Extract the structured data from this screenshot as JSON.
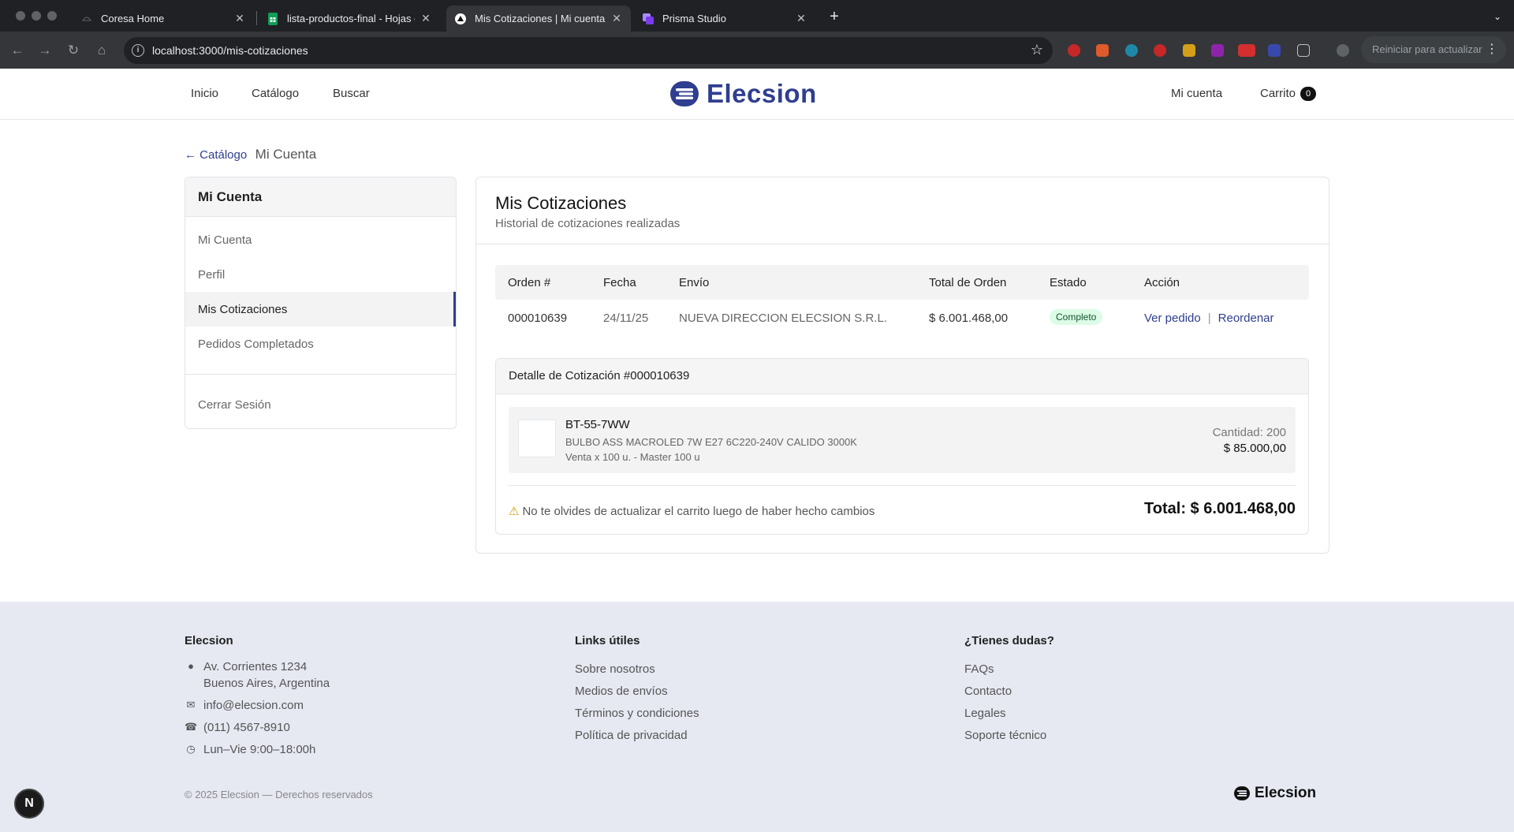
{
  "browser": {
    "tabs": [
      {
        "title": "Coresa Home",
        "icon": "coresa-favicon"
      },
      {
        "title": "lista-productos-final - Hojas de",
        "icon": "sheets-favicon"
      },
      {
        "title": "Mis Cotizaciones | Mi cuenta | ",
        "icon": "vercel-favicon"
      },
      {
        "title": "Prisma Studio",
        "icon": "prisma-favicon"
      }
    ],
    "url": "localhost:3000/mis-cotizaciones",
    "update_button": "Reiniciar para actualizar"
  },
  "header": {
    "nav": [
      "Inicio",
      "Catálogo",
      "Buscar"
    ],
    "brand": "Elecsion",
    "account": "Mi cuenta",
    "cart_label": "Carrito",
    "cart_count": "0",
    "colors": {
      "brand": "#2f3e8f"
    }
  },
  "breadcrumb": {
    "back": "← Catálogo",
    "current": "Mi Cuenta"
  },
  "sidebar": {
    "title": "Mi Cuenta",
    "items": [
      {
        "label": "Mi Cuenta"
      },
      {
        "label": "Perfil"
      },
      {
        "label": "Mis Cotizaciones",
        "active": true
      },
      {
        "label": "Pedidos Completados"
      }
    ],
    "logout": "Cerrar Sesión"
  },
  "main": {
    "title": "Mis Cotizaciones",
    "subtitle": "Historial de cotizaciones realizadas",
    "table": {
      "headers": [
        "Orden #",
        "Fecha",
        "Envío",
        "Total de Orden",
        "Estado",
        "Acción"
      ],
      "rows": [
        {
          "order": "000010639",
          "date": "24/11/25",
          "shipping": "NUEVA DIRECCION ELECSION S.R.L.",
          "total": "$ 6.001.468,00",
          "status": "Completo",
          "view": "Ver pedido",
          "separator": "|",
          "reorder": "Reordenar"
        }
      ]
    },
    "detail": {
      "title": "Detalle de Cotización #000010639",
      "item": {
        "sku": "BT-55-7WW",
        "description": "BULBO ASS MACROLED 7W E27 6C220-240V CALIDO 3000K",
        "pack": "Venta x 100 u. - Master 100 u",
        "quantity": "Cantidad: 200",
        "price": "$ 85.000,00"
      },
      "warning": "No te olvides de actualizar el carrito luego de haber hecho cambios",
      "total": "Total: $ 6.001.468,00"
    }
  },
  "footer": {
    "col1": {
      "title": "Elecsion",
      "address_line1": "Av. Corrientes 1234",
      "address_line2": "Buenos Aires, Argentina",
      "email": "info@elecsion.com",
      "phone": "(011) 4567-8910",
      "hours": "Lun–Vie 9:00–18:00h"
    },
    "col2": {
      "title": "Links útiles",
      "links": [
        "Sobre nosotros",
        "Medios de envíos",
        "Términos y condiciones",
        "Política de privacidad"
      ]
    },
    "col3": {
      "title": "¿Tienes dudas?",
      "links": [
        "FAQs",
        "Contacto",
        "Legales",
        "Soporte técnico"
      ]
    },
    "copyright": "© 2025 Elecsion — Derechos reservados",
    "brand": "Elecsion"
  },
  "dev_badge": "N"
}
